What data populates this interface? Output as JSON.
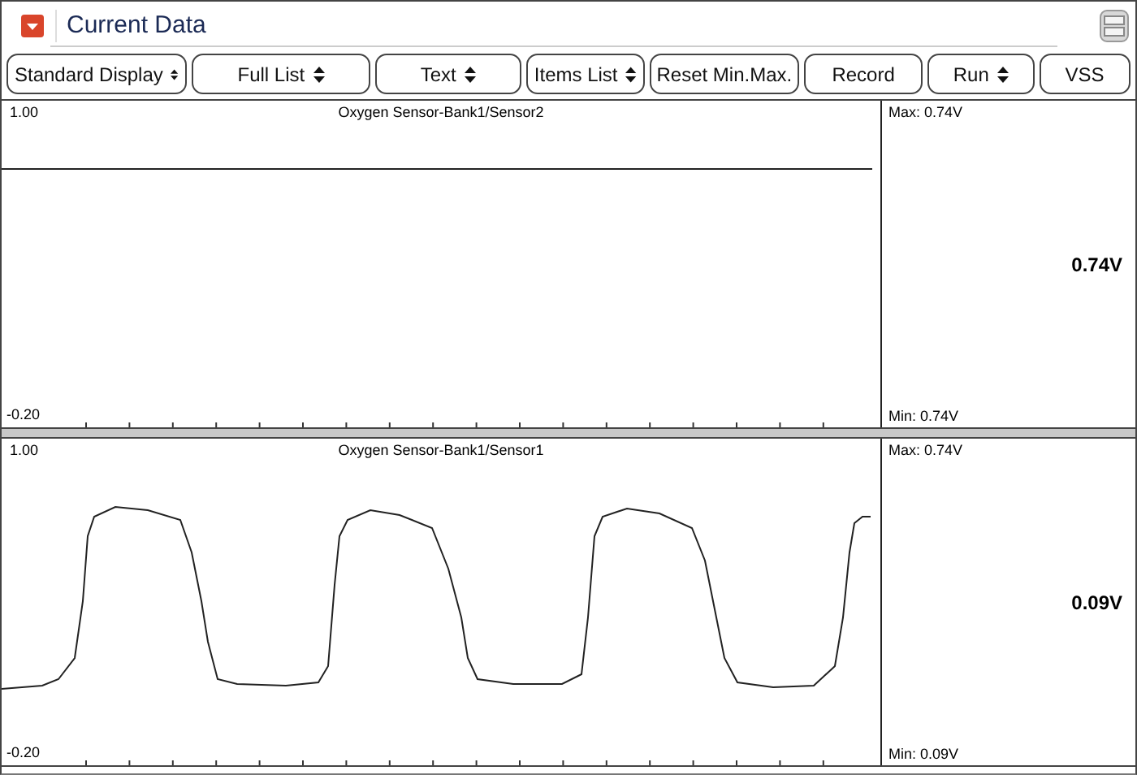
{
  "window": {
    "title": "Current Data"
  },
  "toolbar": [
    {
      "label": "Standard Display",
      "kind": "dropdown"
    },
    {
      "label": "Full List",
      "kind": "dropdown"
    },
    {
      "label": "Text",
      "kind": "dropdown"
    },
    {
      "label": "Items List",
      "kind": "dropdown"
    },
    {
      "label": "Reset Min.Max.",
      "kind": "plain"
    },
    {
      "label": "Record",
      "kind": "plain"
    },
    {
      "label": "Run",
      "kind": "dropdown"
    },
    {
      "label": "VSS",
      "kind": "plain"
    }
  ],
  "graphs": [
    {
      "title": "Oxygen Sensor-Bank1/Sensor2",
      "y_max": "1.00",
      "y_min": "-0.20",
      "max": "Max:  0.74V",
      "value": "0.74V",
      "min": "Min:  0.74V",
      "kind": "flat"
    },
    {
      "title": "Oxygen Sensor-Bank1/Sensor1",
      "y_max": "1.00",
      "y_min": "-0.20",
      "max": "Max:  0.74V",
      "value": "0.09V",
      "min": "Min:  0.09V",
      "kind": "wave"
    }
  ]
}
